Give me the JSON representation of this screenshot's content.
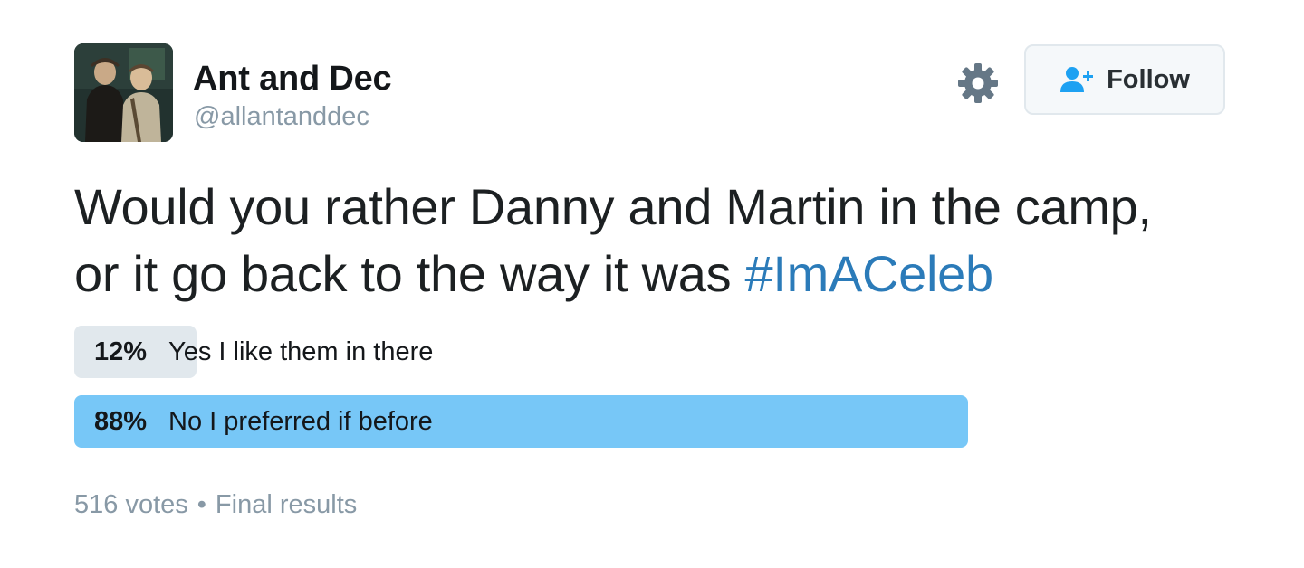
{
  "user": {
    "display_name": "Ant and Dec",
    "handle": "@allantanddec",
    "avatar_icon": "profile-photo"
  },
  "actions": {
    "settings_icon": "gear-icon",
    "follow_icon": "add-user-icon",
    "follow_label": "Follow"
  },
  "tweet": {
    "text_line1": "Would you rather Danny and Martin in the camp,",
    "text_line2": "or it go back to the way it was ",
    "hashtag": "#ImACeleb"
  },
  "poll": {
    "options": [
      {
        "percent_label": "12%",
        "label": "Yes I like them in there",
        "fraction": 0.12,
        "leader": false
      },
      {
        "percent_label": "88%",
        "label": "No I preferred if before",
        "fraction": 0.88,
        "leader": true
      }
    ],
    "votes": "516 votes",
    "separator": "•",
    "status": "Final results"
  },
  "colors": {
    "leader_bar": "#77c7f7",
    "other_bar": "#e1e8ed",
    "hashtag": "#2b7bb9",
    "muted_text": "#8899a6",
    "follow_icon": "#1da1f2"
  }
}
